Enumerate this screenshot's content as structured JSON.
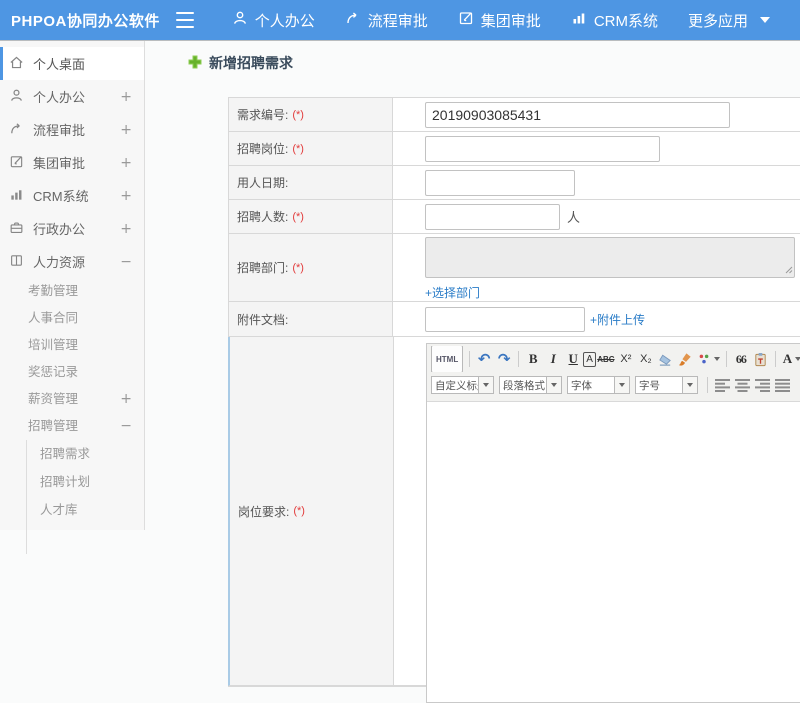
{
  "topbar": {
    "logo": "PHPOA协同办公软件",
    "nav": [
      {
        "label": "个人办公"
      },
      {
        "label": "流程审批"
      },
      {
        "label": "集团审批"
      },
      {
        "label": "CRM系统"
      },
      {
        "label": "更多应用"
      }
    ]
  },
  "sidebar": {
    "items": [
      {
        "label": "个人桌面"
      },
      {
        "label": "个人办公",
        "exp": "+"
      },
      {
        "label": "流程审批",
        "exp": "+"
      },
      {
        "label": "集团审批",
        "exp": "+"
      },
      {
        "label": "CRM系统",
        "exp": "+"
      },
      {
        "label": "行政办公",
        "exp": "+"
      },
      {
        "label": "人力资源",
        "exp": "−"
      }
    ],
    "hr_items": [
      {
        "label": "考勤管理"
      },
      {
        "label": "人事合同"
      },
      {
        "label": "培训管理"
      },
      {
        "label": "奖惩记录"
      },
      {
        "label": "薪资管理",
        "exp": "+"
      },
      {
        "label": "招聘管理",
        "exp": "−"
      }
    ],
    "recruit_items": [
      {
        "label": "招聘需求"
      },
      {
        "label": "招聘计划"
      },
      {
        "label": "人才库"
      }
    ]
  },
  "main": {
    "title": "新增招聘需求",
    "form": {
      "row1": {
        "label": "需求编号:",
        "req": "(*)",
        "value": "20190903085431"
      },
      "row2": {
        "label": "招聘岗位:",
        "req": "(*)"
      },
      "row3": {
        "label": "用人日期:"
      },
      "row4": {
        "label": "招聘人数:",
        "req": "(*)",
        "suffix": "人"
      },
      "row5": {
        "label": "招聘部门:",
        "req": "(*)",
        "link": "+选择部门"
      },
      "row6": {
        "label": "附件文档:",
        "link": "+附件上传"
      },
      "row7": {
        "label": "岗位要求:",
        "req": "(*)"
      }
    },
    "editor": {
      "html_btn": "HTML",
      "undo": "↶",
      "redo": "↷",
      "bold": "B",
      "italic": "I",
      "underline": "U",
      "font_box": "A",
      "strike": "ABC",
      "sup": "X²",
      "sub": "X₂",
      "quote": "66",
      "font_color": "A",
      "highlight": "a",
      "dropdowns": [
        {
          "label": "自定义标题"
        },
        {
          "label": "段落格式"
        },
        {
          "label": "字体"
        },
        {
          "label": "字号"
        }
      ]
    }
  },
  "colors": {
    "topbar_blue": "#4e96e3",
    "link_blue": "#2a7cc7",
    "required_red": "#e23b3b",
    "plus_green": "#67b22b",
    "focus_border_blue": "#a9cbe6"
  }
}
